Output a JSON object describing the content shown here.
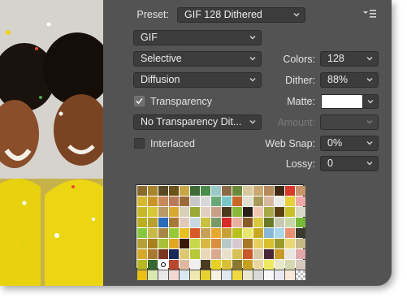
{
  "preset": {
    "label": "Preset:",
    "value": "GIF 128 Dithered"
  },
  "format": {
    "value": "GIF"
  },
  "reduction": {
    "value": "Selective"
  },
  "colors": {
    "label": "Colors:",
    "value": "128"
  },
  "dither_algorithm": {
    "value": "Diffusion"
  },
  "dither": {
    "label": "Dither:",
    "value": "88%"
  },
  "transparency": {
    "label": "Transparency",
    "checked": true
  },
  "matte": {
    "label": "Matte:",
    "color": "#ffffff"
  },
  "transparency_dither": {
    "value": "No Transparency Dit..."
  },
  "amount": {
    "label": "Amount:",
    "value": ""
  },
  "interlaced": {
    "label": "Interlaced",
    "checked": false
  },
  "web_snap": {
    "label": "Web Snap:",
    "value": "0%"
  },
  "lossy": {
    "label": "Lossy:",
    "value": "0"
  },
  "color_table": {
    "columns": 16,
    "colors": [
      "#8a6a2c",
      "#a8842e",
      "#5a4a24",
      "#6a5218",
      "#c9a64a",
      "#3e6a38",
      "#4a8a4a",
      "#9ac8c4",
      "#8a6a44",
      "#6a8a3a",
      "#d8c8a0",
      "#c8a870",
      "#b48a5a",
      "#3e2a14",
      "#d83a2a",
      "#c89468",
      "#d8b830",
      "#c89628",
      "#c88a58",
      "#b87a58",
      "#9a6a3a",
      "#c8c8c8",
      "#d8d8d8",
      "#6aa878",
      "#78c8c8",
      "#c86828",
      "#e0e0d0",
      "#a89a58",
      "#d8b8a0",
      "#eaeaea",
      "#e8d038",
      "#f0a8a8",
      "#c8b828",
      "#d8c838",
      "#b89a68",
      "#d8a830",
      "#d8d0b8",
      "#9aa838",
      "#e0d0c0",
      "#c8a088",
      "#4a3a1a",
      "#8ab838",
      "#282018",
      "#f0c8b0",
      "#a8a848",
      "#5a4010",
      "#c8c028",
      "#d8d8c8",
      "#b8b020",
      "#b8a030",
      "#2a6ab8",
      "#a87838",
      "#e0c8b8",
      "#c8d8e0",
      "#c8c040",
      "#7a9a6a",
      "#d82828",
      "#e8b0a0",
      "#8a5a28",
      "#d8c840",
      "#6a7a28",
      "#c8c8b0",
      "#c8d8a8",
      "#78b838",
      "#88c840",
      "#c8b848",
      "#a88848",
      "#98c838",
      "#e8c020",
      "#d85828",
      "#c8a058",
      "#e8a830",
      "#c8a038",
      "#b8c020",
      "#e8e870",
      "#c8a820",
      "#88b8d8",
      "#a8d8e8",
      "#e89070",
      "#3a3a30",
      "#b8a038",
      "#a88020",
      "#a8c038",
      "#e0a820",
      "#3a1808",
      "#c8d848",
      "#d8b840",
      "#d89040",
      "#b8c8c8",
      "#d8c8d0",
      "#a87828",
      "#e8d060",
      "#d8c030",
      "#9a9a2a",
      "#e8d878",
      "#c8b888",
      "#d8a828",
      "#a87830",
      "#7a3820",
      "#1a2858",
      "#e0c870",
      "#b8c838",
      "#e8d8b8",
      "#d8a890",
      "#e8e0c8",
      "#d8c058",
      "#c85828",
      "#d8c8a8",
      "#482838",
      "#c89828",
      "#e8e8e0",
      "#e0a8a8",
      "#b8b820",
      "#386830",
      "#ffffff",
      "#b84830",
      "#e0b8a0",
      "#f0f0f0",
      "#4a3a20",
      "#e8d020",
      "#d8c038",
      "#8a7830",
      "#c8a020",
      "#e8d8a0",
      "#f0e860",
      "#e8e8c8",
      "#d8d8b0",
      "#d8c8c0",
      "#e8c018",
      "#d8e8b0",
      "#e8e8e8",
      "#f0d8d0",
      "#d8e8f0",
      "#f0e8b0",
      "#e8d030",
      "#f8f0e0",
      "#e0e8f0",
      "#f0d840",
      "#e8e8d0",
      "#d8d8d8",
      "#f8f8f8",
      "#e8e8f0",
      "#f8e8d8",
      "transparent"
    ],
    "selected_index": 114
  }
}
